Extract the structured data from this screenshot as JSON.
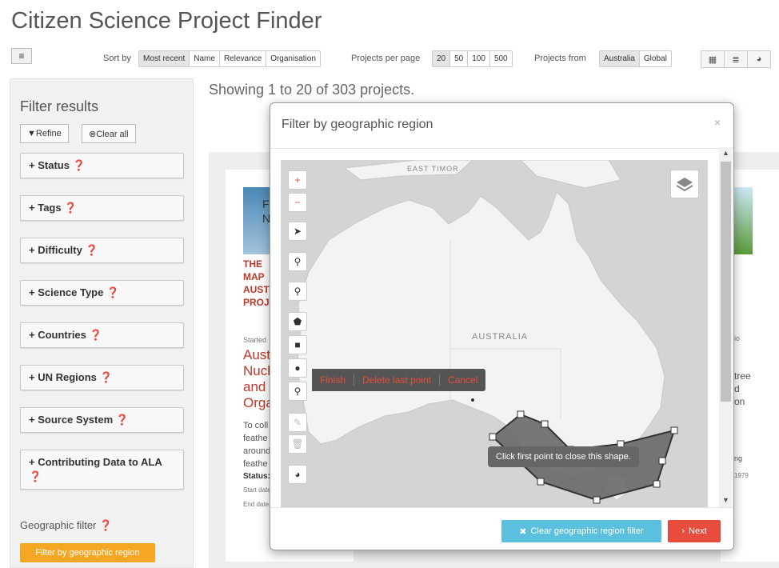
{
  "page": {
    "title": "Citizen Science Project Finder"
  },
  "toolbar": {
    "sort_label": "Sort by",
    "sort_options": [
      "Most recent",
      "Name",
      "Relevance",
      "Organisation"
    ],
    "per_page_label": "Projects per page",
    "per_page_options": [
      "20",
      "50",
      "100",
      "500"
    ],
    "from_label": "Projects from",
    "from_options": [
      "Australia",
      "Global"
    ]
  },
  "sidebar": {
    "title": "Filter results",
    "refine": "Refine",
    "clear_all": "Clear all",
    "facets": [
      "Status",
      "Tags",
      "Difficulty",
      "Science Type",
      "Countries",
      "UN Regions",
      "Source System",
      "Contributing Data to ALA"
    ],
    "geo_label": "Geographic filter",
    "geo_button": "Filter by geographic region"
  },
  "results": {
    "showing": "Showing 1 to 20 of 303 projects."
  },
  "background_card": {
    "title_lines": [
      "THE",
      "MAP",
      "AUST",
      "PROJ"
    ],
    "image_text": [
      "F",
      "N"
    ],
    "started": "Started",
    "name_lines": [
      "Austr",
      "Nucle",
      "and T",
      "Orga"
    ],
    "desc_lines": [
      "To coll",
      "feathe",
      "around",
      "feathe"
    ],
    "status": "Status:",
    "start_date": "Start date",
    "end_date": "End date:",
    "right_fragments": [
      "io",
      "tree",
      "d",
      "on",
      "ng",
      "1979"
    ]
  },
  "modal": {
    "title": "Filter by geographic region",
    "close": "×",
    "draw_actions": [
      "Finish",
      "Delete last point",
      "Cancel"
    ],
    "tooltip": "Click first point to close this shape.",
    "map_labels": {
      "country": "AUSTRALIA",
      "region": "EAST TIMOR"
    },
    "clear_button": "Clear geographic region filter",
    "next_button": "Next"
  },
  "colors": {
    "accent_orange": "#f5a623",
    "danger_red": "#e74c3c",
    "info_blue": "#5bc0de"
  }
}
